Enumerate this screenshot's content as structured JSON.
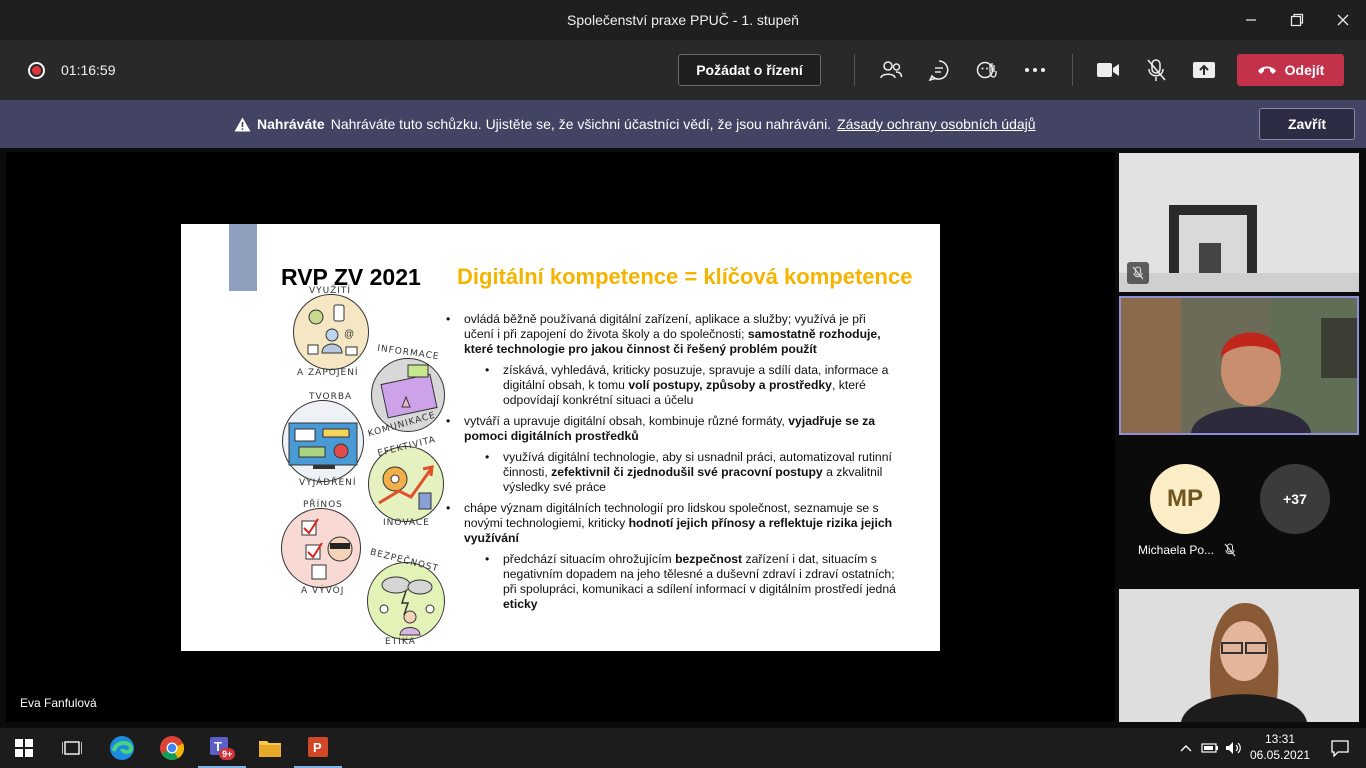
{
  "window": {
    "title": "Společenství praxe PPUČ - 1. stupeň"
  },
  "toolbar": {
    "timer": "01:16:59",
    "request_control": "Požádat o řízení",
    "leave": "Odejít"
  },
  "banner": {
    "label": "Nahráváte",
    "message": "Nahráváte tuto schůzku. Ujistěte se, že všichni účastníci vědí, že jsou nahráváni.",
    "link": "Zásady ochrany osobních údajů",
    "close": "Zavřít"
  },
  "stage": {
    "presenter": "Eva Fanfulová"
  },
  "slide": {
    "title_left": "RVP ZV 2021",
    "title_right": "Digitální kompetence = klíčová kompetence",
    "circle_labels": {
      "c1_top": "VYUŽITÍ",
      "c1_bottom": "A ZAPOJENÍ",
      "c2_top": "INFORMACE",
      "c2_bottom": "KOMUNIKACE",
      "c3_top": "TVORBA",
      "c3_bottom": "VYJÁDŘENÍ",
      "c4_top": "EFEKTIVITA",
      "c4_bottom": "INOVACE",
      "c5_top": "PŘÍNOS",
      "c5_bottom": "A VÝVOJ",
      "c6_top": "BEZPEČNOST",
      "c6_bottom": "ETIKA"
    },
    "b1": {
      "t1": "ovládá běžně používaná digitální zařízení, aplikace a služby; využívá je při učení i při zapojení do života školy a do společnosti; ",
      "b": "samostatně rozhoduje, které technologie pro jakou činnost či řešený problém použít"
    },
    "b1a": {
      "t1": "získává, vyhledává, kriticky posuzuje, spravuje a sdílí data, informace a digitální obsah, k tomu ",
      "b": "volí postupy, způsoby a prostředky",
      "t2": ", které odpovídají konkrétní situaci a účelu"
    },
    "b2": {
      "t1": "vytváří a upravuje digitální obsah, kombinuje různé formáty, ",
      "b": "vyjadřuje se za pomoci digitálních prostředků"
    },
    "b2a": {
      "t1": "využívá digitální technologie, aby si usnadnil práci, automatizoval rutinní činnosti, ",
      "b": "zefektivnil či zjednodušil své pracovní postupy",
      "t2": " a zkvalitnil výsledky své práce"
    },
    "b3": {
      "t1": "chápe význam digitálních technologií pro lidskou společnost, seznamuje se s novými technologiemi, kriticky ",
      "b": "hodnotí jejich přínosy a reflektuje rizika jejich využívání"
    },
    "b3a": {
      "t1": "předchází situacím ohrožujícím ",
      "b": "bezpečnost",
      "t2": " zařízení i dat, situacím s negativním dopadem na jeho tělesné a duševní zdraví i zdraví ostatních; při spolupráci, komunikaci a sdílení informací v digitálním prostředí jedná ",
      "b2": "eticky"
    }
  },
  "participants": {
    "mp_initials": "MP",
    "mp_name": "Michaela Po...",
    "more": "+37"
  },
  "taskbar": {
    "teams_badge": "9+",
    "time": "13:31",
    "date": "06.05.2021"
  },
  "colors": {
    "accent_yellow": "#f5b400",
    "leave_red": "#c4314b",
    "banner_bg": "#434364",
    "active_tile_border": "#8f8fd8"
  }
}
